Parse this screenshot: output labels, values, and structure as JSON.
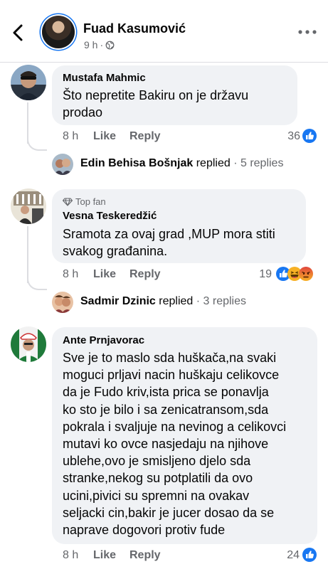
{
  "header": {
    "name": "Fuad Kasumović",
    "time": "9 h"
  },
  "comments": [
    {
      "author": "Mustafa Mahmic",
      "lines": [
        "Što nepretite Bakiru on je državu",
        "prodao"
      ],
      "time": "8 h",
      "like": "Like",
      "reply": "Reply",
      "reaction_count": "36",
      "reactions": [
        "like-icon"
      ],
      "replies": {
        "name": "Edin Behisa Bošnjak",
        "replied": "replied",
        "count": "· 5 replies"
      }
    },
    {
      "badge": "Top fan",
      "author": "Vesna Teskeredžić",
      "lines": [
        "Sramota za ovaj grad ,MUP mora stiti",
        "svakog građanina."
      ],
      "time": "8 h",
      "like": "Like",
      "reply": "Reply",
      "reaction_count": "19",
      "reactions": [
        "like-icon",
        "haha-icon",
        "angry-icon"
      ],
      "replies": {
        "name": "Sadmir Dzinic",
        "replied": "replied",
        "count": "· 3 replies"
      }
    },
    {
      "author": "Ante Prnjavorac",
      "lines": [
        "Sve je to maslo sda huškača,na svaki",
        "moguci prljavi nacin huškaju celikovce",
        "da je Fudo kriv,ista prica se ponavlja",
        "ko sto je bilo i sa zenicatransom,sda",
        "pokrala i svaljuje na nevinog a celikovci",
        "mutavi ko ovce nasjedaju na njihove",
        "ublehe,ovo je smisljeno djelo sda",
        "stranke,nekog su potplatili da ovo",
        "ucini,pivici su spremni na ovakav",
        "seljacki cin,bakir je jucer dosao da se",
        "naprave dogovori protiv fude"
      ],
      "time": "8 h",
      "like": "Like",
      "reply": "Reply",
      "reaction_count": "24",
      "reactions": [
        "like-icon"
      ]
    }
  ],
  "colors": {
    "brand_blue": "#1877f2",
    "bubble_bg": "#f0f2f5",
    "muted_text": "#65676b",
    "thread_line": "#dcdde1"
  }
}
